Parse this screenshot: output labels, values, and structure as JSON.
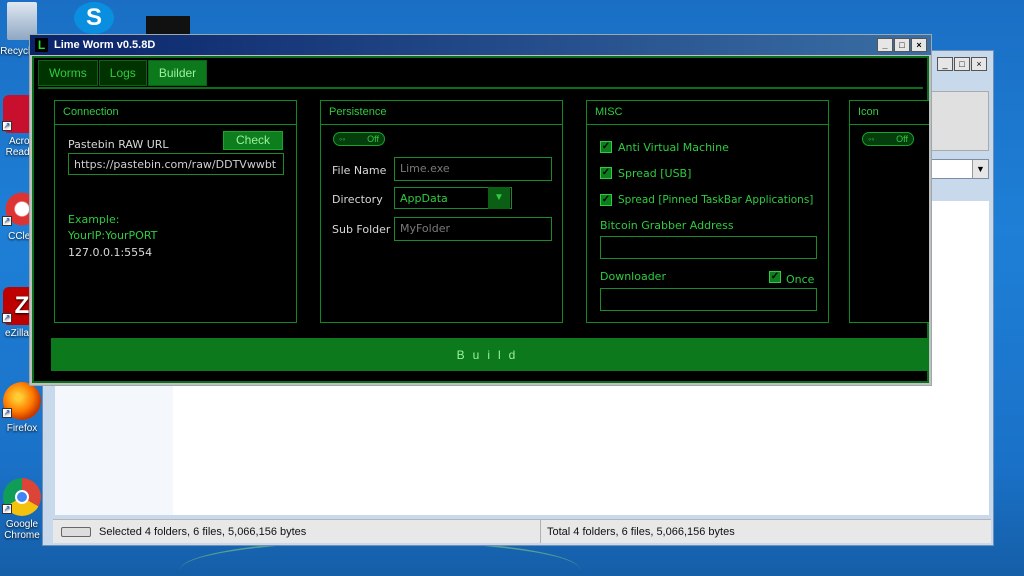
{
  "desktop": {
    "icons": [
      {
        "label": "Recycle",
        "icon": "recycle-bin-icon"
      },
      {
        "label": "Acrob\nReader",
        "icon": "acrobat-reader-icon"
      },
      {
        "label": "CClea",
        "icon": "ccleaner-icon"
      },
      {
        "label": "eZilla C",
        "icon": "filezilla-icon"
      },
      {
        "label": "Firefox",
        "icon": "firefox-icon"
      },
      {
        "label": "Google\nChrome",
        "icon": "chrome-icon"
      }
    ]
  },
  "explorer": {
    "status_left": "Selected 4 folders, 6 files, 5,066,156 bytes",
    "status_right": "Total 4 folders, 6 files, 5,066,156 bytes"
  },
  "app": {
    "title": "Lime Worm v0.5.8D",
    "logo": "L",
    "tabs": [
      "Worms",
      "Logs",
      "Builder"
    ],
    "active_tab": "Builder",
    "connection": {
      "title": "Connection",
      "pastebin_label": "Pastebin RAW URL",
      "check_label": "Check",
      "url_value": "https://pastebin.com/raw/DDTVwwbt",
      "example_label": "Example:",
      "example_format": "YourIP:YourPORT",
      "example_value": "127.0.0.1:5554"
    },
    "persistence": {
      "title": "Persistence",
      "toggle_label": "Off",
      "file_name_label": "File Name",
      "file_name_value": "Lime.exe",
      "directory_label": "Directory",
      "directory_value": "AppData",
      "subfolder_label": "Sub Folder",
      "subfolder_value": "MyFolder"
    },
    "misc": {
      "title": "MISC",
      "anti_vm_label": "Anti Virtual Machine",
      "spread_usb_label": "Spread [USB]",
      "spread_taskbar_label": "Spread [Pinned TaskBar Applications]",
      "bitcoin_label": "Bitcoin Grabber Address",
      "bitcoin_value": "",
      "downloader_label": "Downloader",
      "once_label": "Once",
      "downloader_value": ""
    },
    "icon_panel": {
      "title": "Icon",
      "toggle_label": "Off"
    },
    "build_label": "Build"
  }
}
